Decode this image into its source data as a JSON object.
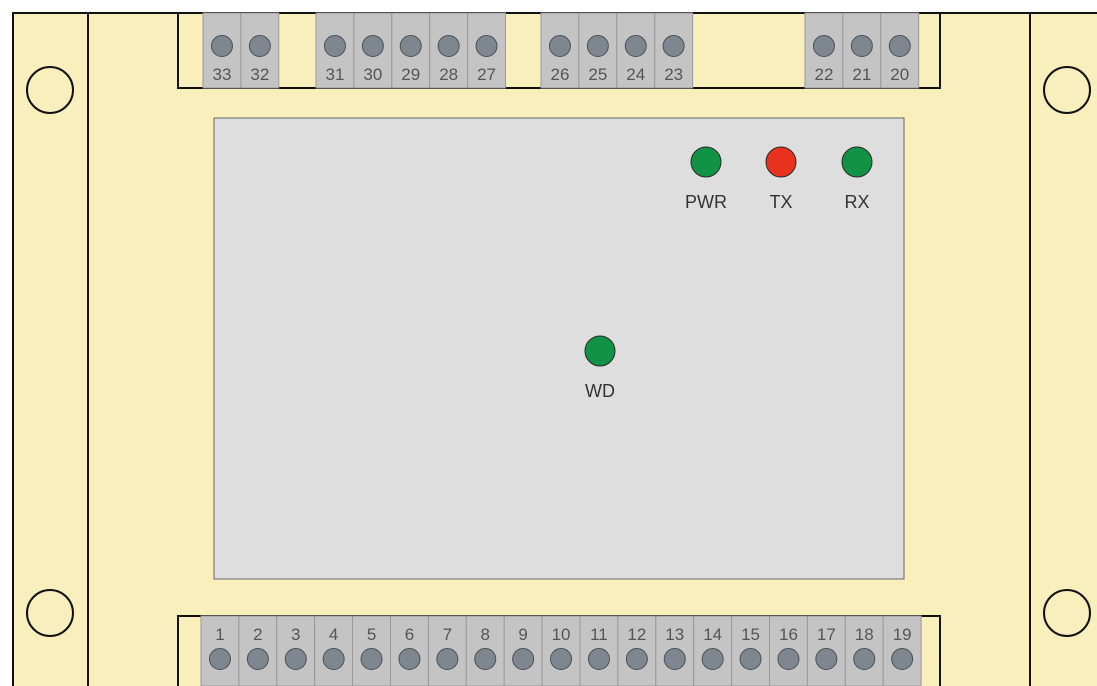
{
  "device": {
    "body_color": "#f8efbd",
    "panel_color": "#dedede",
    "terminal_color": "#c4c4c4",
    "screw_color": "#7e8790"
  },
  "top_terminals": {
    "groups": [
      [
        "33",
        "32"
      ],
      [
        "31",
        "30",
        "29",
        "28",
        "27"
      ],
      [
        "26",
        "25",
        "24",
        "23"
      ],
      [
        "22",
        "21",
        "20"
      ]
    ]
  },
  "bottom_terminals": {
    "labels": [
      "1",
      "2",
      "3",
      "4",
      "5",
      "6",
      "7",
      "8",
      "9",
      "10",
      "11",
      "12",
      "13",
      "14",
      "15",
      "16",
      "17",
      "18",
      "19"
    ]
  },
  "leds": [
    {
      "label": "PWR",
      "color": "#119245"
    },
    {
      "label": "TX",
      "color": "#e8321e"
    },
    {
      "label": "RX",
      "color": "#119245"
    },
    {
      "label": "WD",
      "color": "#119245"
    }
  ]
}
